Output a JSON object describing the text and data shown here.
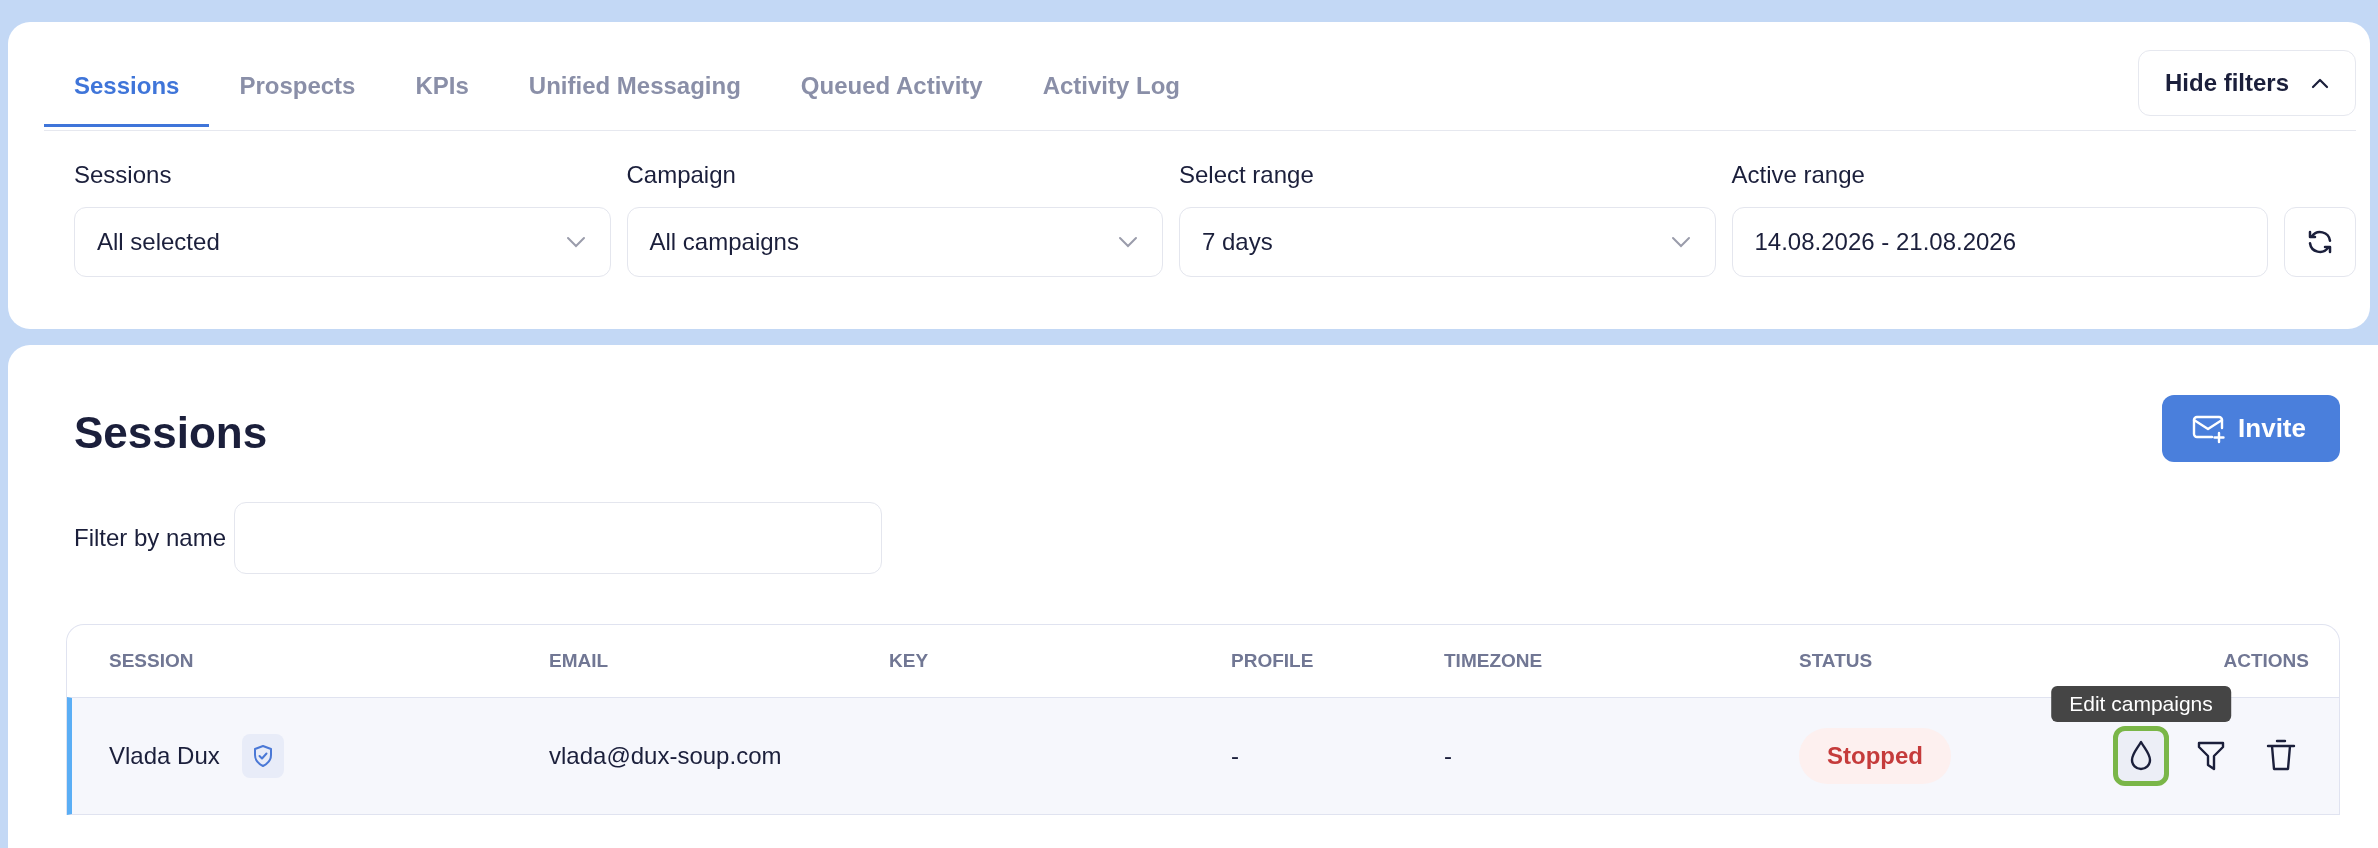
{
  "tabs": [
    {
      "label": "Sessions",
      "selected": true
    },
    {
      "label": "Prospects",
      "selected": false
    },
    {
      "label": "KPIs",
      "selected": false
    },
    {
      "label": "Unified Messaging",
      "selected": false
    },
    {
      "label": "Queued Activity",
      "selected": false
    },
    {
      "label": "Activity Log",
      "selected": false
    }
  ],
  "hide_filters_button": {
    "label": "Hide filters",
    "expanded": true
  },
  "filters": [
    {
      "label": "Sessions",
      "value": "All selected",
      "kind": "select"
    },
    {
      "label": "Campaign",
      "value": "All campaigns",
      "kind": "select"
    },
    {
      "label": "Select range",
      "value": "7 days",
      "kind": "select"
    },
    {
      "label": "Active range",
      "value": "14.08.2026 - 21.08.2026",
      "kind": "text"
    }
  ],
  "sessions": {
    "title": "Sessions",
    "invite_button": "Invite",
    "filter": {
      "label": "Filter by name"
    },
    "table": {
      "columns": [
        "SESSION",
        "EMAIL",
        "KEY",
        "PROFILE",
        "TIMEZONE",
        "STATUS",
        "ACTIONS"
      ],
      "rows": [
        {
          "session": "Vlada Dux",
          "verified": true,
          "email": "vlada@dux-soup.com",
          "profile": "-",
          "timezone": "-",
          "status": {
            "label": "Stopped",
            "kind": "stopped"
          },
          "selected": true,
          "actions": [
            {
              "kind": "campaigns",
              "tooltip": "Edit campaigns",
              "focused": true
            },
            {
              "kind": "filter",
              "focused": false
            },
            {
              "kind": "delete",
              "focused": false
            }
          ]
        }
      ]
    }
  }
}
